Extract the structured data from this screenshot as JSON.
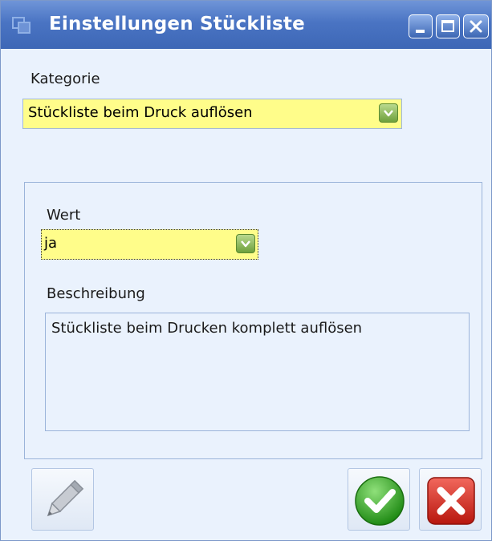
{
  "window": {
    "title": "Einstellungen Stückliste"
  },
  "kategorie": {
    "label": "Kategorie",
    "value": "Stückliste beim Druck auflösen"
  },
  "wert": {
    "label": "Wert",
    "value": "ja"
  },
  "beschreibung": {
    "label": "Beschreibung",
    "text": "Stückliste beim Drucken komplett auflösen"
  },
  "icons": {
    "app": "window-app-icon",
    "minimize": "minimize-icon",
    "maximize": "maximize-icon",
    "close": "close-icon",
    "dropdown": "chevron-down-icon",
    "edit": "pencil-icon",
    "confirm": "checkmark-icon",
    "cancel": "cross-icon"
  },
  "colors": {
    "titlebar": "#4a74c3",
    "window_bg": "#eaf2fd",
    "combo_bg": "#fffd8a",
    "confirm": "#2ea31c",
    "cancel": "#d8261b"
  }
}
